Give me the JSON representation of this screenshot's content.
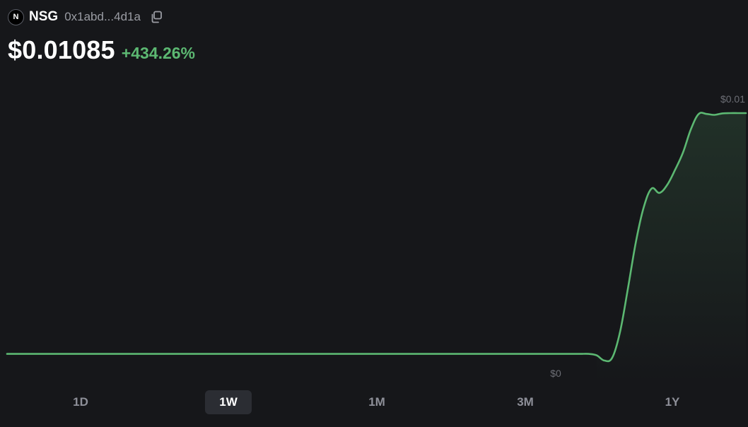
{
  "token": {
    "logo_letter": "N",
    "symbol": "NSG",
    "address": "0x1abd...4d1a"
  },
  "price": {
    "value": "$0.01085",
    "change": "+434.26%"
  },
  "colors": {
    "background": "#16171a",
    "positive": "#5cb872",
    "muted_text": "#9a9ca3",
    "tab_active_bg": "#2b2d33"
  },
  "icons": {
    "copy": "copy-icon"
  },
  "chart_data": {
    "type": "line",
    "series": [
      {
        "values": [
          0.00203,
          0.00203,
          0.00203,
          0.00203,
          0.00203,
          0.00203,
          0.00203,
          0.00203,
          0.00203,
          0.00203,
          0.00203,
          0.00203,
          0.00203,
          0.00203,
          0.00203,
          0.00203,
          0.00203,
          0.00203,
          0.00203,
          0.00203,
          0.00203,
          0.00203,
          0.00203,
          0.00203,
          0.00203,
          0.00203,
          0.00203,
          0.00203,
          0.00203,
          0.00203,
          0.00203,
          0.00203,
          0.00203,
          0.00203,
          0.00203,
          0.00203,
          0.00203,
          0.00203,
          0.00203,
          0.00203,
          0.00203,
          0.00203,
          0.00203,
          0.00203,
          0.00203,
          0.00203,
          0.00203,
          0.00203,
          0.00203,
          0.00203,
          0.00203,
          0.00203,
          0.00203,
          0.00203,
          0.00203,
          0.00203,
          0.00203,
          0.00203,
          0.00203,
          0.00203,
          0.00203,
          0.00203,
          0.00203,
          0.00203,
          0.00203,
          0.00203,
          0.00203,
          0.00203,
          0.00203,
          0.00203,
          0.00203,
          0.00203,
          0.00203,
          0.00203,
          0.00203,
          0.00198,
          0.0018,
          0.0019,
          0.0028,
          0.0043,
          0.0059,
          0.0071,
          0.00775,
          0.0076,
          0.00788,
          0.0084,
          0.009,
          0.0098,
          0.01033,
          0.01033,
          0.0103,
          0.01035,
          0.01036,
          0.01036,
          0.01036
        ]
      }
    ],
    "price_labels": {
      "high": "$0.01",
      "low": "$0"
    },
    "range_options": [
      "1D",
      "1W",
      "1M",
      "3M",
      "1Y"
    ],
    "selected_range": "1W",
    "line_color": "#5cb872",
    "fill": "gradient",
    "grid": false
  }
}
